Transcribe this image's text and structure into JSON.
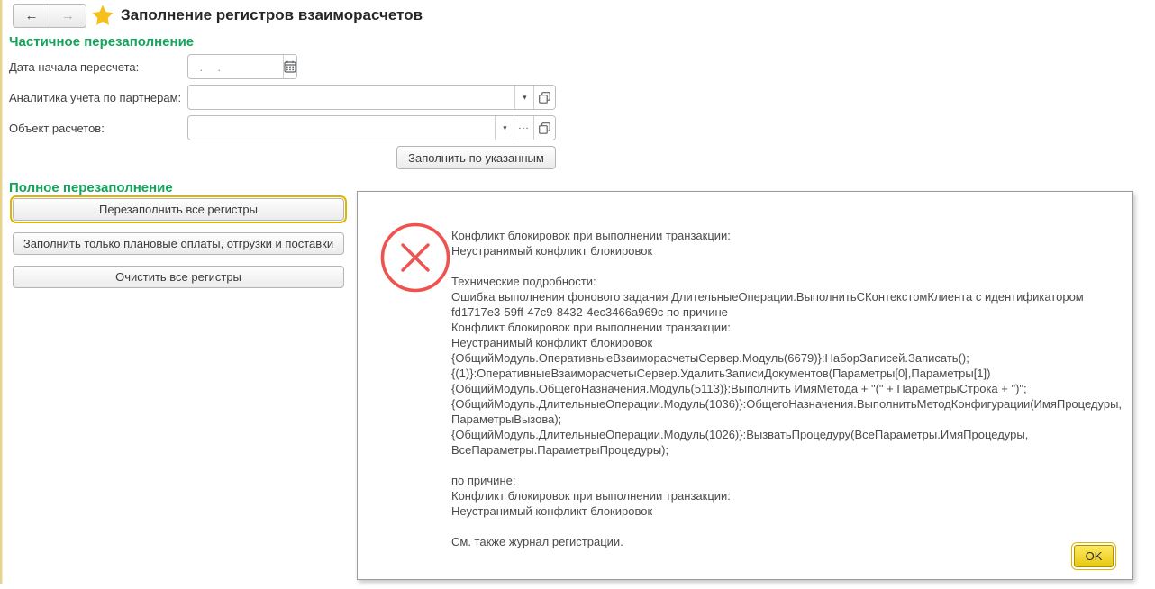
{
  "header": {
    "title": "Заполнение регистров взаиморасчетов"
  },
  "icons": {
    "back": "←",
    "forward": "→",
    "dropdown": "▼",
    "ellipsis": "..."
  },
  "colors": {
    "section_green": "#12a45b",
    "focus_gold": "#e0b400",
    "accent_strip": "#e6d38c",
    "error_red": "#ef5350",
    "star_yellow": "#f5c01d"
  },
  "sections": {
    "partial": {
      "title": "Частичное перезаполнение",
      "fields": [
        {
          "label": "Дата начала пересчета:",
          "value": "",
          "placeholder": " .  .",
          "type": "date"
        },
        {
          "label": "Аналитика учета по партнерам:",
          "value": "",
          "placeholder": "",
          "type": "reference"
        },
        {
          "label": "Объект расчетов:",
          "value": "",
          "placeholder": "",
          "type": "reference"
        }
      ],
      "fill_button_label": "Заполнить по указанным"
    },
    "full": {
      "title": "Полное перезаполнение",
      "buttons": [
        "Перезаполнить все регистры",
        "Заполнить только плановые оплаты, отгрузки и поставки",
        "Очистить все регистры"
      ]
    }
  },
  "dialog": {
    "message_lines": [
      "Конфликт блокировок при выполнении транзакции:",
      "Неустранимый конфликт блокировок",
      "",
      "Технические подробности:",
      "Ошибка выполнения фонового задания ДлительныеОперации.ВыполнитьСКонтекстомКлиента с идентификатором",
      "fd1717e3-59ff-47c9-8432-4ec3466a969c по причине",
      "Конфликт блокировок при выполнении транзакции:",
      "Неустранимый конфликт блокировок",
      "{ОбщийМодуль.ОперативныеВзаиморасчетыСервер.Модуль(6679)}:НаборЗаписей.Записать();",
      "{(1)}:ОперативныеВзаиморасчетыСервер.УдалитьЗаписиДокументов(Параметры[0],Параметры[1])",
      "{ОбщийМодуль.ОбщегоНазначения.Модуль(5113)}:Выполнить ИмяМетода + \"(\" + ПараметрыСтрока + \")\";",
      "{ОбщийМодуль.ДлительныеОперации.Модуль(1036)}:ОбщегоНазначения.ВыполнитьМетодКонфигурации(ИмяПроцедуры,",
      "ПараметрыВызова);",
      "{ОбщийМодуль.ДлительныеОперации.Модуль(1026)}:ВызватьПроцедуру(ВсеПараметры.ИмяПроцедуры,",
      "ВсеПараметры.ПараметрыПроцедуры);",
      "",
      "по причине:",
      "Конфликт блокировок при выполнении транзакции:",
      "Неустранимый конфликт блокировок",
      "",
      "См. также журнал регистрации."
    ],
    "ok_label": "OK"
  }
}
